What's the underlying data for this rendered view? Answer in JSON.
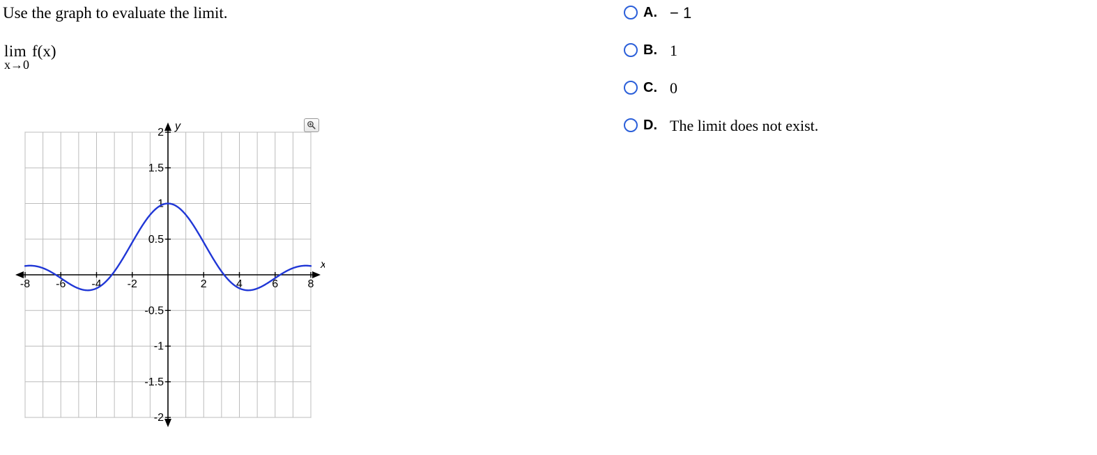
{
  "prompt": "Use the graph to evaluate the limit.",
  "limit": {
    "lim": "lim",
    "sub": "x→0",
    "fx": "f(x)"
  },
  "options": {
    "a": {
      "letter": "A.",
      "text": "− 1"
    },
    "b": {
      "letter": "B.",
      "text": "1"
    },
    "c": {
      "letter": "C.",
      "text": "0"
    },
    "d": {
      "letter": "D.",
      "text": "The limit does not exist."
    }
  },
  "chart_data": {
    "type": "line",
    "title": "",
    "xlabel": "x",
    "ylabel": "y",
    "xlim": [
      -8,
      8
    ],
    "ylim": [
      -2,
      2
    ],
    "xticks": [
      -8,
      -6,
      -4,
      -2,
      2,
      4,
      6,
      8
    ],
    "yticks": [
      -2,
      -1.5,
      -1,
      -0.5,
      0.5,
      1,
      1.5,
      2
    ],
    "grid": true,
    "series": [
      {
        "name": "f(x)",
        "x": [
          -8,
          -7,
          -6,
          -5,
          -4,
          -3,
          -2,
          -1,
          0,
          1,
          2,
          3,
          4,
          5,
          6,
          7,
          8
        ],
        "y": [
          0.12,
          0.09,
          0.05,
          -0.04,
          -0.19,
          -0.05,
          0.45,
          0.84,
          1.0,
          0.84,
          0.45,
          -0.05,
          -0.19,
          -0.04,
          0.05,
          0.09,
          0.12
        ]
      }
    ]
  },
  "axis_labels": {
    "x": "x",
    "y": "y"
  }
}
